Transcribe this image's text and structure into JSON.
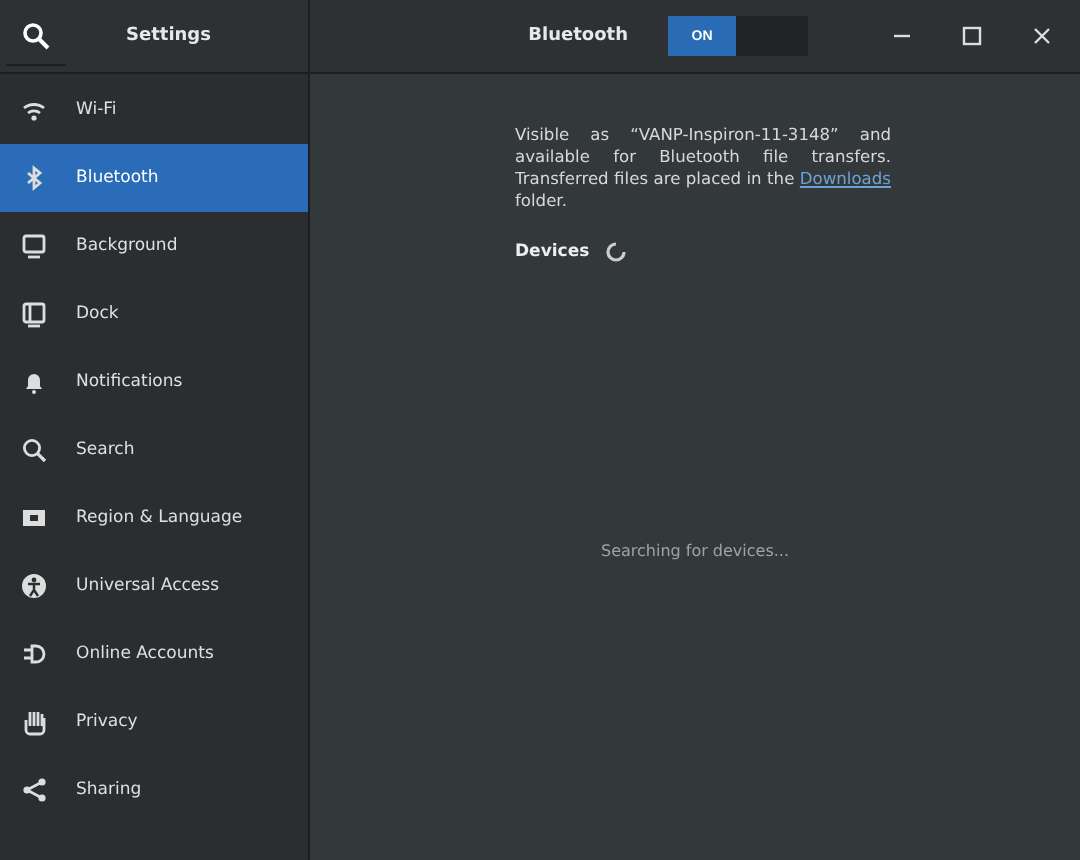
{
  "header": {
    "title": "Settings",
    "panel_title": "Bluetooth",
    "switch": {
      "label": "ON",
      "on": true
    }
  },
  "sidebar": {
    "items": [
      {
        "label": "Wi-Fi",
        "kind": "wifi",
        "selected": false
      },
      {
        "label": "Bluetooth",
        "kind": "bluetooth",
        "selected": true
      },
      {
        "label": "Background",
        "kind": "monitor",
        "selected": false
      },
      {
        "label": "Dock",
        "kind": "dock",
        "selected": false
      },
      {
        "label": "Notifications",
        "kind": "bell",
        "selected": false
      },
      {
        "label": "Search",
        "kind": "search",
        "selected": false
      },
      {
        "label": "Region & Language",
        "kind": "flag",
        "selected": false
      },
      {
        "label": "Universal Access",
        "kind": "person",
        "selected": false
      },
      {
        "label": "Online Accounts",
        "kind": "plug",
        "selected": false
      },
      {
        "label": "Privacy",
        "kind": "hand",
        "selected": false
      },
      {
        "label": "Sharing",
        "kind": "share",
        "selected": false
      }
    ]
  },
  "main": {
    "description": "Visible as “VANP-Inspiron-11-3148” and available for Bluetooth file transfers. Transferred files are placed in the",
    "link": "Downloads",
    "description_end": "folder.",
    "devices_label": "Devices",
    "status": "Searching for devices..."
  }
}
